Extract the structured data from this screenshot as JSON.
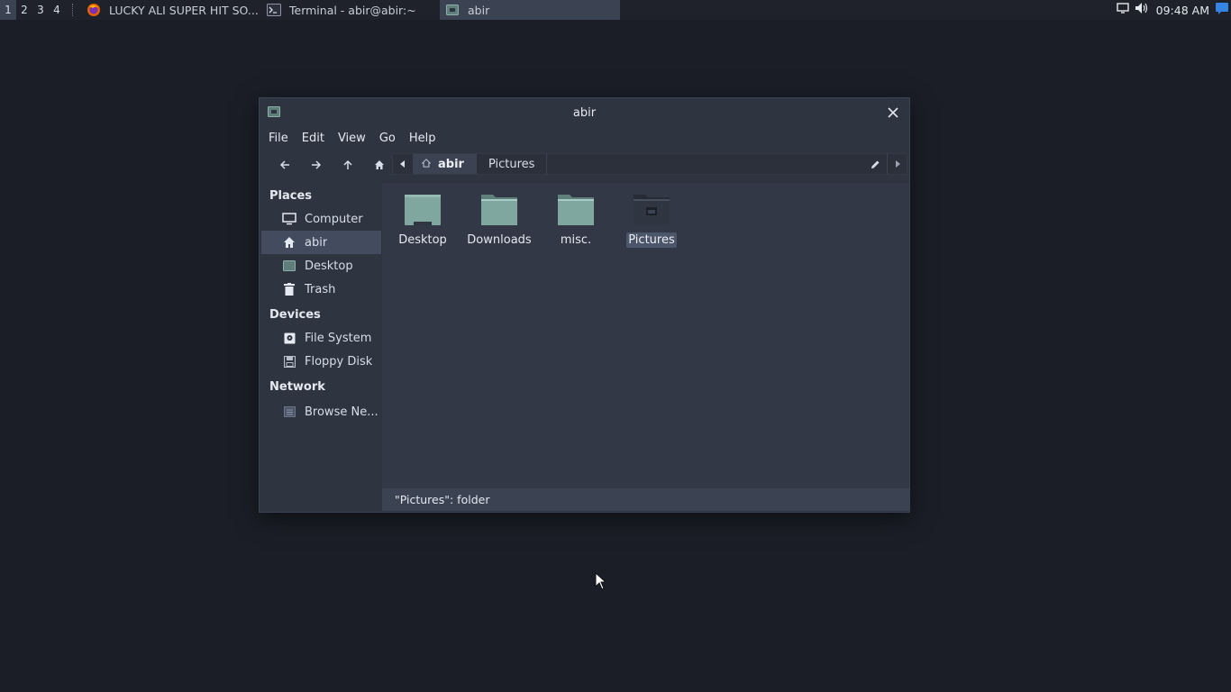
{
  "panel": {
    "workspaces": [
      "1",
      "2",
      "3",
      "4"
    ],
    "tasks": [
      {
        "label": "LUCKY ALI SUPER HIT SO...",
        "icon": "firefox-icon"
      },
      {
        "label": "Terminal - abir@abir:~",
        "icon": "terminal-icon"
      },
      {
        "label": "abir",
        "icon": "file-manager-icon"
      }
    ],
    "clock": "09:48 AM"
  },
  "window": {
    "title": "abir",
    "menu": [
      "File",
      "Edit",
      "View",
      "Go",
      "Help"
    ],
    "path": {
      "home": "abir",
      "child": "Pictures"
    },
    "sidebar": {
      "places_title": "Places",
      "places": [
        {
          "label": "Computer",
          "icon": "monitor-icon"
        },
        {
          "label": "abir",
          "icon": "home-icon"
        },
        {
          "label": "Desktop",
          "icon": "desktop-icon"
        },
        {
          "label": "Trash",
          "icon": "trash-icon"
        }
      ],
      "devices_title": "Devices",
      "devices": [
        {
          "label": "File System",
          "icon": "drive-icon"
        },
        {
          "label": "Floppy Disk",
          "icon": "floppy-icon"
        }
      ],
      "network_title": "Network",
      "network": [
        {
          "label": "Browse Ne...",
          "icon": "network-icon"
        }
      ]
    },
    "files": [
      {
        "label": "Desktop",
        "icon": "desktop-folder-icon"
      },
      {
        "label": "Downloads",
        "icon": "folder-icon"
      },
      {
        "label": "misc.",
        "icon": "folder-icon"
      },
      {
        "label": "Pictures",
        "icon": "pictures-folder-icon",
        "selected": true
      }
    ],
    "status": "\"Pictures\": folder"
  },
  "colors": {
    "desktop_bg": "#1b1e27",
    "window_bg": "#2e3440",
    "selection": "#434c5e",
    "folder": "#7fa7a0",
    "accent": "#3584e4"
  }
}
